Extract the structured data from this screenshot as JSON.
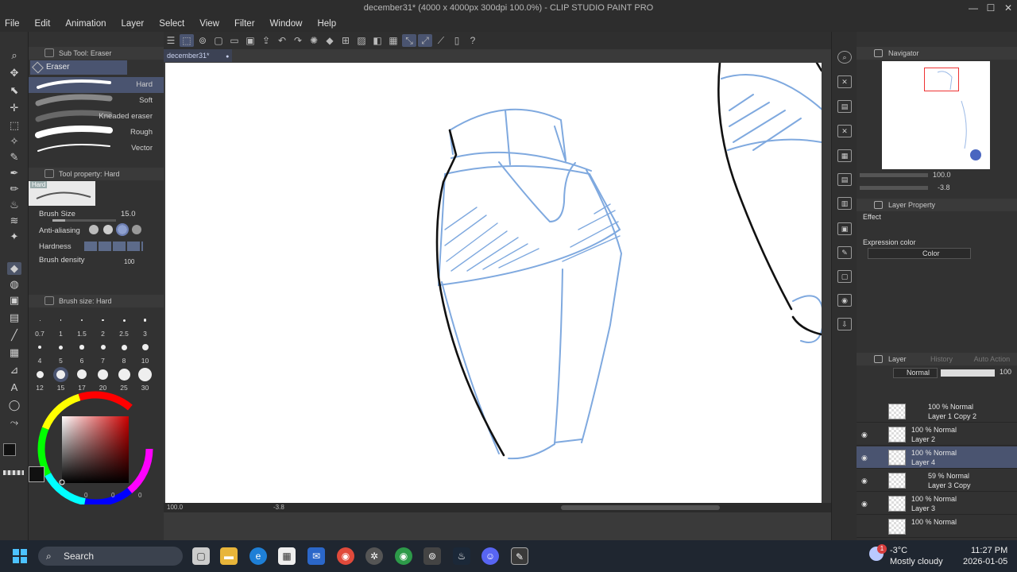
{
  "title": "december31* (4000 x 4000px 300dpi 100.0%) - CLIP STUDIO PAINT PRO",
  "window_controls": {
    "minimize": "—",
    "maximize": "☐",
    "close": "✕"
  },
  "menu": [
    "File",
    "Edit",
    "Animation",
    "Layer",
    "Select",
    "View",
    "Filter",
    "Window",
    "Help"
  ],
  "subtool": {
    "header": "Sub Tool: Eraser",
    "tab": "Eraser",
    "brushes": [
      "Hard",
      "Soft",
      "Kneaded eraser",
      "Rough",
      "Vector"
    ]
  },
  "tool_property": {
    "header": "Tool property: Hard",
    "preview_label": "Hard",
    "brush_size_label": "Brush Size",
    "brush_size_value": "15.0",
    "antialias_label": "Anti-aliasing",
    "hardness_label": "Hardness",
    "density_label": "Brush density",
    "density_value": "100"
  },
  "brush_size_panel": {
    "header": "Brush size: Hard",
    "sizes": [
      "0.7",
      "1",
      "1.5",
      "2",
      "2.5",
      "3",
      "4",
      "5",
      "6",
      "7",
      "8",
      "10",
      "12",
      "15",
      "17",
      "20",
      "25",
      "30"
    ]
  },
  "color_values": {
    "v1": "0",
    "v2": "0",
    "v3": "0"
  },
  "document_tab": "december31*",
  "status": {
    "zoom": "100.0",
    "angle": "-3.8"
  },
  "navigator": {
    "header": "Navigator",
    "zoom": "100.0",
    "angle": "-3.8"
  },
  "layer_property": {
    "header": "Layer Property",
    "effect_label": "Effect",
    "expression_label": "Expression color",
    "expression_value": "Color"
  },
  "layer_panel": {
    "tabs": [
      "Layer",
      "History",
      "Auto Action"
    ],
    "blend_mode": "Normal",
    "opacity": "100",
    "layers": [
      {
        "mode": "100 % Normal",
        "name": "Layer 1 Copy 2"
      },
      {
        "mode": "100 % Normal",
        "name": "Layer 2"
      },
      {
        "mode": "100 % Normal",
        "name": "Layer 4"
      },
      {
        "mode": "59 % Normal",
        "name": "Layer 3 Copy"
      },
      {
        "mode": "100 % Normal",
        "name": "Layer 3"
      },
      {
        "mode": "100 % Normal",
        "name": ""
      }
    ]
  },
  "taskbar": {
    "search": "Search",
    "weather_temp": "-3°C",
    "weather_desc": "Mostly cloudy",
    "time": "11:27 PM",
    "date": "2026-01-05",
    "badge": "1"
  },
  "colors": {
    "accent": "#4a5470",
    "sketch_blue": "#7ea8e0"
  }
}
